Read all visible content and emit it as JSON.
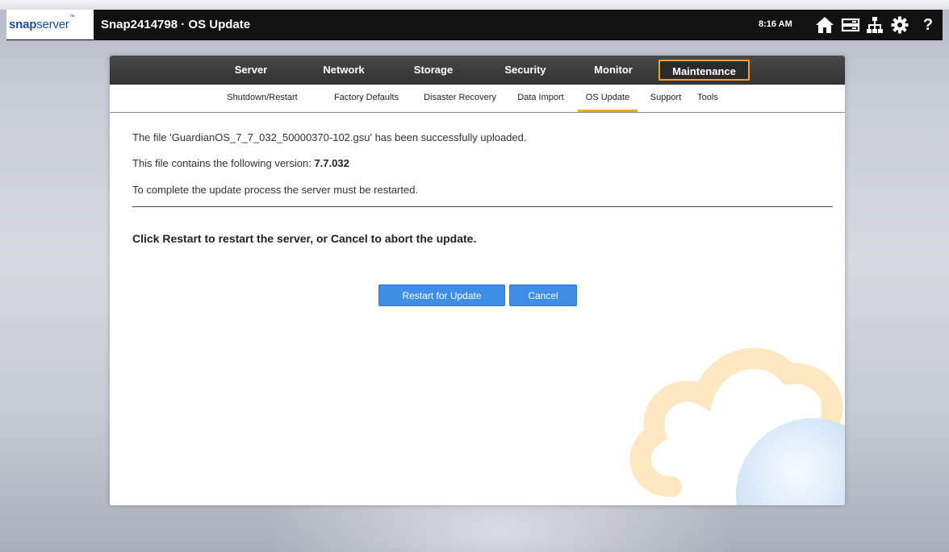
{
  "brand": {
    "logo_primary": "snap",
    "logo_secondary": "server",
    "logo_mark": "™",
    "color": "#1d4e9c"
  },
  "header": {
    "title": "Snap2414798 · OS Update",
    "time": "8:16 AM",
    "icons": [
      "home-icon",
      "server-icon",
      "network-icon",
      "gear-icon",
      "help-icon"
    ],
    "help_glyph": "?"
  },
  "main_nav": {
    "tabs": [
      {
        "label": "Server",
        "active": false
      },
      {
        "label": "Network",
        "active": false
      },
      {
        "label": "Storage",
        "active": false
      },
      {
        "label": "Security",
        "active": false
      },
      {
        "label": "Monitor",
        "active": false
      },
      {
        "label": "Maintenance",
        "active": true
      }
    ],
    "accent": "#f3a21d"
  },
  "sub_nav": {
    "items": [
      {
        "label": "Shutdown/Restart",
        "active": false
      },
      {
        "label": "Factory Defaults",
        "active": false
      },
      {
        "label": "Disaster Recovery",
        "active": false
      },
      {
        "label": "Data Import",
        "active": false
      },
      {
        "label": "OS Update",
        "active": true
      },
      {
        "label": "Support",
        "active": false
      },
      {
        "label": "Tools",
        "active": false
      }
    ]
  },
  "content": {
    "upload_message": "The file 'GuardianOS_7_7_032_50000370-102.gsu' has been successfully uploaded.",
    "version_prefix": "This file contains the following version: ",
    "version": "7.7.032",
    "restart_notice": "To complete the update process the server must be restarted.",
    "instruction": "Click Restart to restart the server, or Cancel to abort the update."
  },
  "actions": {
    "restart_label": "Restart for Update",
    "cancel_label": "Cancel",
    "button_color": "#3e8ee6"
  }
}
